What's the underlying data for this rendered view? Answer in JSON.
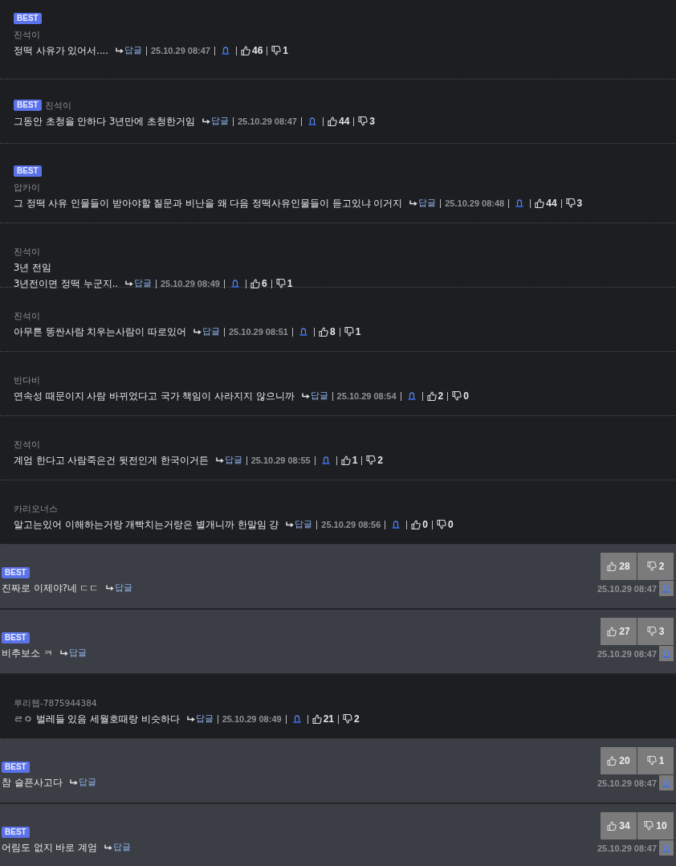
{
  "comments": [
    {
      "kind": "stacked",
      "badge": "BEST",
      "author": "진석이",
      "lines": [
        "정떡 사유가 있어서...."
      ],
      "reply": "답글",
      "date": "25.10.29 08:47",
      "likes": "46",
      "dislikes": "1"
    },
    {
      "kind": "inline-author",
      "badge": "BEST",
      "author": "진석이",
      "lines": [
        "그동안 초청을 안하다 3년만에 초청한거임"
      ],
      "reply": "답글",
      "date": "25.10.29 08:47",
      "likes": "44",
      "dislikes": "3"
    },
    {
      "kind": "stacked",
      "badge": "BEST",
      "author": "압카이",
      "lines": [
        "그 정떡 사유 인물들이 받아야할 질문과 비난을 왜 다음 정떡사유인물들이 듣고있냐 이거지"
      ],
      "reply": "답글",
      "date": "25.10.29 08:48",
      "likes": "44",
      "dislikes": "3"
    },
    {
      "kind": "stacked",
      "author": "진석이",
      "lines": [
        "3년 전임",
        "3년전이면 정떡 누군지.."
      ],
      "reply": "답글",
      "date": "25.10.29 08:49",
      "likes": "6",
      "dislikes": "1"
    },
    {
      "kind": "stacked",
      "author": "진석이",
      "lines": [
        "아무튼 똥싼사람 치우는사람이 따로있어"
      ],
      "reply": "답글",
      "date": "25.10.29 08:51",
      "likes": "8",
      "dislikes": "1"
    },
    {
      "kind": "stacked",
      "author": "반다비",
      "lines": [
        "연속성 때문이지 사람 바뀌었다고 국가 책임이 사라지지 않으니까"
      ],
      "reply": "답글",
      "date": "25.10.29 08:54",
      "likes": "2",
      "dislikes": "0"
    },
    {
      "kind": "stacked",
      "author": "진석이",
      "lines": [
        "계엄 한다고 사람죽은건 뒷전인게 한국이거든"
      ],
      "reply": "답글",
      "date": "25.10.29 08:55",
      "likes": "1",
      "dislikes": "2"
    },
    {
      "kind": "stacked",
      "author": "카리오너스",
      "lines": [
        "알고는있어 이해하는거랑 개빡치는거랑은 별개니까 한말임 걍"
      ],
      "reply": "답글",
      "date": "25.10.29 08:56",
      "likes": "0",
      "dislikes": "0"
    },
    {
      "kind": "card",
      "badge": "BEST",
      "lines": [
        "진짜로 이제야?네 ㄷㄷ"
      ],
      "reply": "답글",
      "date": "25.10.29 08:47",
      "likes": "28",
      "dislikes": "2"
    },
    {
      "kind": "card",
      "badge": "BEST",
      "lines": [
        "비추보소 ㅋ"
      ],
      "reply": "답글",
      "date": "25.10.29 08:47",
      "likes": "27",
      "dislikes": "3"
    },
    {
      "kind": "stacked",
      "author": "루리웹-7875944384",
      "lines": [
        "ㄹㅇ 벌레들 있음 세월호때랑 비슷하다"
      ],
      "reply": "답글",
      "date": "25.10.29 08:49",
      "likes": "21",
      "dislikes": "2"
    },
    {
      "kind": "card",
      "badge": "BEST",
      "lines": [
        "참 슬픈사고다"
      ],
      "reply": "답글",
      "date": "25.10.29 08:47",
      "likes": "20",
      "dislikes": "1"
    },
    {
      "kind": "card",
      "badge": "BEST",
      "lines": [
        "어림도 없지 바로 계엄"
      ],
      "reply": "답글",
      "date": "25.10.29 08:47",
      "likes": "34",
      "dislikes": "10"
    }
  ]
}
